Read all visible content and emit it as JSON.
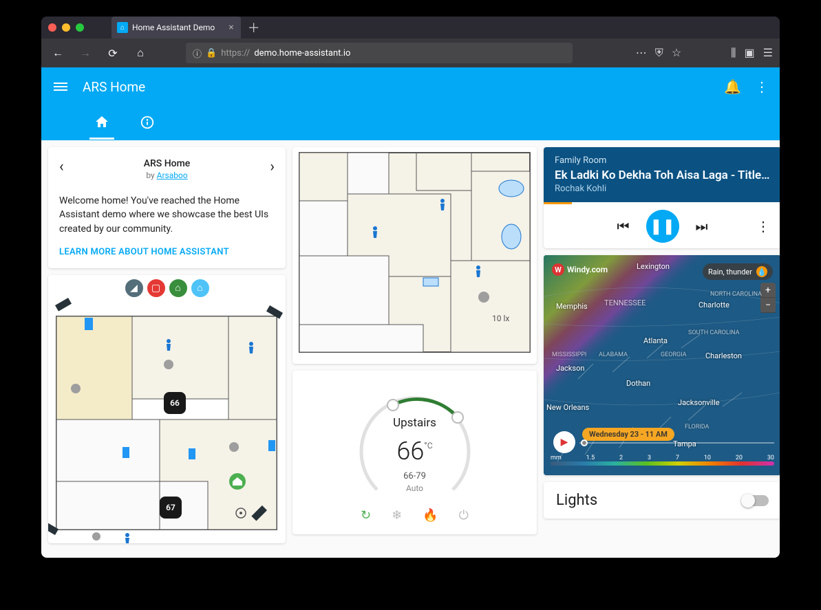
{
  "browser": {
    "tab_title": "Home Assistant Demo",
    "url_prefix": "https://",
    "url_host": "demo.home-assistant.io",
    "url_path": ""
  },
  "header": {
    "title": "ARS Home"
  },
  "welcome": {
    "title": "ARS Home",
    "by_prefix": "by ",
    "author": "Arsaboo",
    "body": "Welcome home! You've reached the Home Assistant demo where we showcase the best UIs created by our community.",
    "link": "LEARN MORE ABOUT HOME ASSISTANT"
  },
  "floorplan_main": {
    "thermostat1": "66",
    "thermostat2": "67"
  },
  "floorplan_upper": {
    "lux_label": "10 lx"
  },
  "thermostat": {
    "name": "Upstairs",
    "current": "66",
    "unit": "°C",
    "range": "66-79",
    "mode": "Auto"
  },
  "media": {
    "room": "Family Room",
    "title": "Ek Ladki Ko Dekha Toh Aisa Laga - Title…",
    "artist": "Rochak Kohli"
  },
  "weather": {
    "provider": "Windy.com",
    "layer": "Rain, thunder",
    "timestamp": "Wednesday 23 - 11 AM",
    "legend_unit": "mm",
    "legend_ticks": [
      "1.5",
      "2",
      "3",
      "7",
      "10",
      "20",
      "30"
    ],
    "cities": {
      "lexington": "Lexington",
      "memphis": "Memphis",
      "tennessee": "TENNESSEE",
      "charlotte": "Charlotte",
      "nc": "NORTH CAROLINA",
      "atlanta": "Atlanta",
      "sc": "SOUTH CAROLINA",
      "mississippi": "MISSISSIPPI",
      "alabama": "ALABAMA",
      "georgia": "GEORGIA",
      "charleston": "Charleston",
      "jackson": "Jackson",
      "dothan": "Dothan",
      "jacksonville": "Jacksonville",
      "neworleans": "New Orleans",
      "florida": "FLORIDA",
      "tampa": "Tampa"
    }
  },
  "lights": {
    "title": "Lights"
  }
}
